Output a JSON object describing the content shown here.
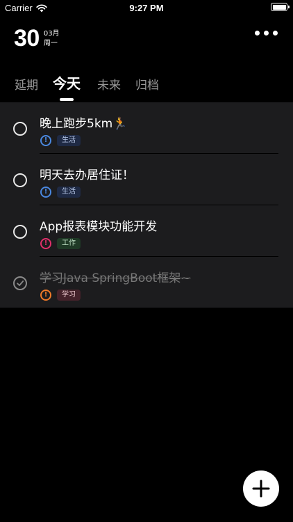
{
  "status_bar": {
    "carrier": "Carrier",
    "time": "9:27 PM"
  },
  "header": {
    "day": "30",
    "month": "03月",
    "weekday": "周一"
  },
  "tabs": [
    {
      "label": "延期",
      "active": false
    },
    {
      "label": "今天",
      "active": true
    },
    {
      "label": "未来",
      "active": false
    },
    {
      "label": "归档",
      "active": false
    }
  ],
  "tasks": [
    {
      "title": "晚上跑步5km🏃",
      "done": false,
      "priority_color": "#4a88e0",
      "tag": "生活",
      "tag_bg": "#1f2a44",
      "tag_color": "#b8c8e8"
    },
    {
      "title": "明天去办居住证！",
      "done": false,
      "priority_color": "#4a88e0",
      "tag": "生活",
      "tag_bg": "#1f2a44",
      "tag_color": "#b8c8e8"
    },
    {
      "title": "App报表模块功能开发",
      "done": false,
      "priority_color": "#e0306a",
      "tag": "工作",
      "tag_bg": "#1f3a26",
      "tag_color": "#bfe0c4"
    },
    {
      "title": "学习Java SpringBoot框架~",
      "done": true,
      "priority_color": "#f07a28",
      "tag": "学习",
      "tag_bg": "#44222a",
      "tag_color": "#e8c4ca"
    }
  ],
  "icons": {
    "priority": "!",
    "more": "ellipsis-icon",
    "add": "plus-icon"
  }
}
